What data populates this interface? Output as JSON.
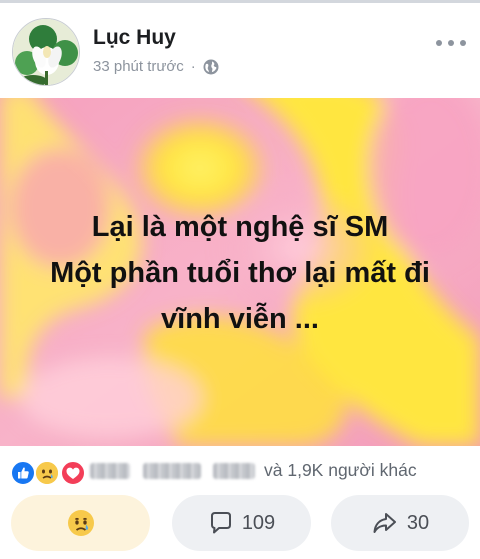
{
  "post": {
    "author": "Lục Huy",
    "time": "33 phút trước",
    "separator": "·",
    "privacy_icon": "globe-icon",
    "text_lines": [
      "Lại là một nghệ sĩ SM",
      "Một phần tuổi thơ lại mất đi",
      "vĩnh viễn ..."
    ],
    "background": {
      "colors": [
        "#f49ab8",
        "#ffe23a",
        "#ffb4c8"
      ]
    }
  },
  "reactions": {
    "icons": [
      "like-icon",
      "sad-icon",
      "love-icon"
    ],
    "others_text": "và 1,9K người khác"
  },
  "actions": {
    "react": {
      "icon": "sad-face-icon"
    },
    "comment": {
      "icon": "comment-icon",
      "count": "109"
    },
    "share": {
      "icon": "share-icon",
      "count": "30"
    }
  },
  "colors": {
    "text_muted": "#8d949e",
    "like_blue": "#1877f2",
    "love_red": "#f33e58"
  }
}
